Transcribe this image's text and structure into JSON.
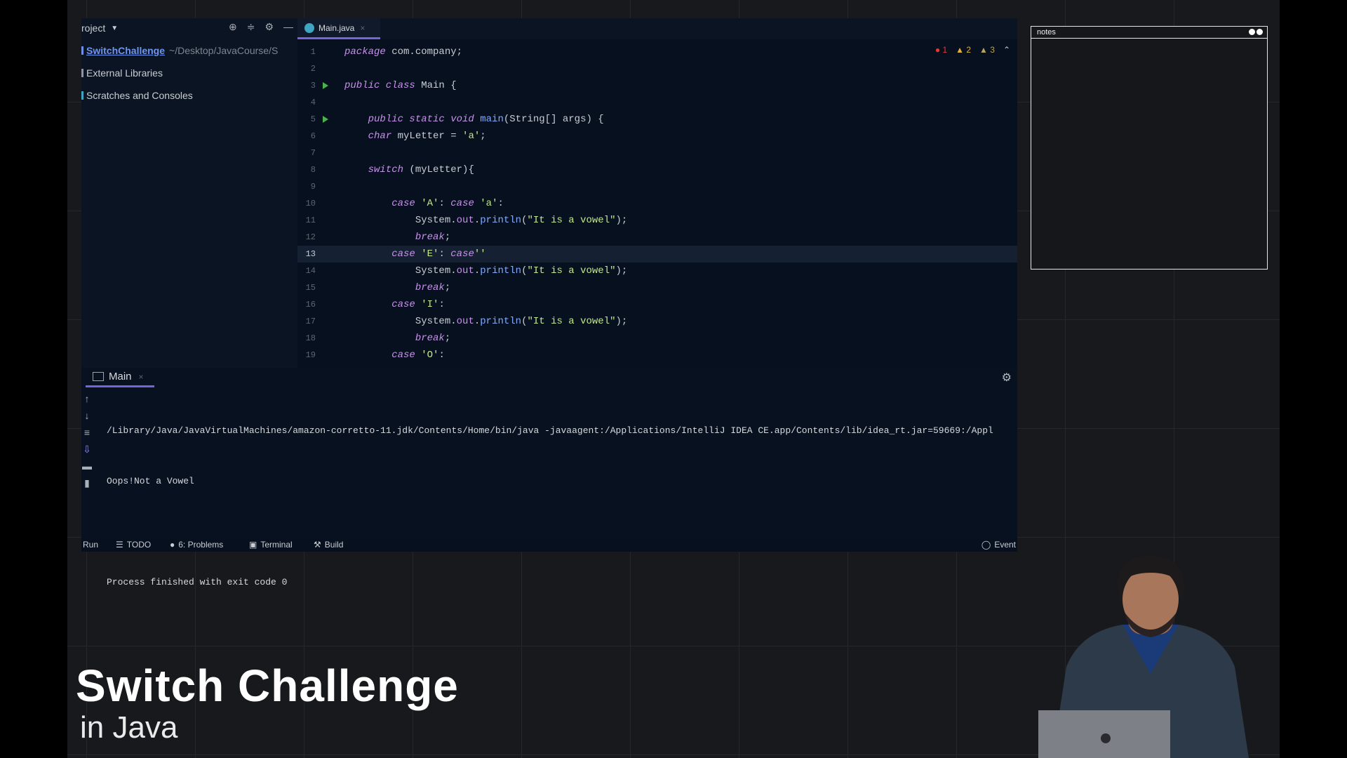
{
  "project": {
    "title": "roject",
    "tree": [
      {
        "name": "SwitchChallenge",
        "path": "~/Desktop/JavaCourse/S"
      },
      {
        "name": "External Libraries",
        "path": ""
      },
      {
        "name": "Scratches and Consoles",
        "path": ""
      }
    ]
  },
  "editor": {
    "tab_label": "Main.java",
    "inspections": {
      "errors": "1",
      "warnings": "2",
      "weak": "3"
    },
    "current_line": 13
  },
  "code_lines": [
    {
      "n": "1",
      "html": "<span class=\"kw\">package</span> com.company;"
    },
    {
      "n": "2",
      "html": ""
    },
    {
      "n": "3",
      "html": "<span class=\"kw\">public class</span> Main {"
    },
    {
      "n": "4",
      "html": ""
    },
    {
      "n": "5",
      "html": "    <span class=\"kw\">public static void</span> <span class=\"fn\">main</span>(String[] args) {"
    },
    {
      "n": "6",
      "html": "    <span class=\"kw\">char</span> myLetter = <span class=\"str\">'a'</span>;"
    },
    {
      "n": "7",
      "html": ""
    },
    {
      "n": "8",
      "html": "    <span class=\"kw\">switch</span> (myLetter){"
    },
    {
      "n": "9",
      "html": ""
    },
    {
      "n": "10",
      "html": "        <span class=\"kw\">case</span> <span class=\"str\">'A'</span>: <span class=\"kw\">case</span> <span class=\"str\">'a'</span>:"
    },
    {
      "n": "11",
      "html": "            System.<span class=\"fld\">out</span>.<span class=\"fn\">println</span>(<span class=\"str\">\"It is a vowel\"</span>);"
    },
    {
      "n": "12",
      "html": "            <span class=\"kw\">break</span>;"
    },
    {
      "n": "13",
      "html": "        <span class=\"kw\">case</span> <span class=\"str\">'E'</span>: <span class=\"kw\">case</span><span class=\"str\">''</span>"
    },
    {
      "n": "14",
      "html": "            System.<span class=\"fld\">out</span>.<span class=\"fn\">println</span>(<span class=\"str\">\"It is a vowel\"</span>);"
    },
    {
      "n": "15",
      "html": "            <span class=\"kw\">break</span>;"
    },
    {
      "n": "16",
      "html": "        <span class=\"kw\">case</span> <span class=\"str\">'I'</span>:"
    },
    {
      "n": "17",
      "html": "            System.<span class=\"fld\">out</span>.<span class=\"fn\">println</span>(<span class=\"str\">\"It is a vowel\"</span>);"
    },
    {
      "n": "18",
      "html": "            <span class=\"kw\">break</span>;"
    },
    {
      "n": "19",
      "html": "        <span class=\"kw\">case</span> <span class=\"str\">'O'</span>:"
    }
  ],
  "run_panel": {
    "tab_label": "Main",
    "console": [
      "/Library/Java/JavaVirtualMachines/amazon-corretto-11.jdk/Contents/Home/bin/java -javaagent:/Applications/IntelliJ IDEA CE.app/Contents/lib/idea_rt.jar=59669:/Appl",
      "Oops!Not a Vowel",
      "",
      "Process finished with exit code 0"
    ]
  },
  "status_bar": {
    "run": "Run",
    "todo": "TODO",
    "problems": "6: Problems",
    "terminal": "Terminal",
    "build": "Build",
    "event": "Event"
  },
  "notes": {
    "title": "notes"
  },
  "caption": {
    "title": "Switch Challenge",
    "subtitle": "in Java"
  },
  "colors": {
    "accent": "#7a63d9",
    "editor_bg": "#06101e",
    "keyword": "#c792ea",
    "string": "#c3e88d"
  }
}
